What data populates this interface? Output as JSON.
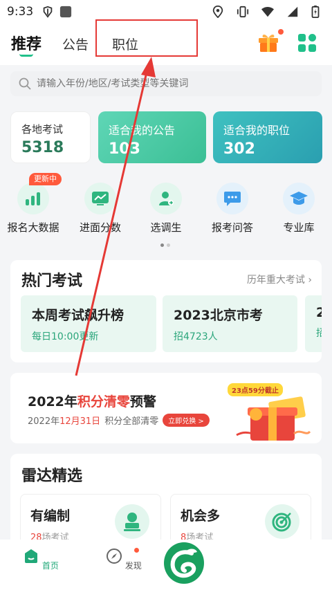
{
  "status_bar": {
    "time": "9:33",
    "icons": [
      "debug-bug-icon",
      "app-square-icon",
      "location-icon",
      "vibrate-icon",
      "wifi-icon",
      "signal-icon",
      "battery-icon"
    ]
  },
  "top_tabs": [
    {
      "label": "推荐",
      "active": true
    },
    {
      "label": "公告",
      "active": false
    },
    {
      "label": "职位",
      "active": false
    }
  ],
  "search": {
    "placeholder": "请输入年份/地区/考试类型等关键词"
  },
  "stats": {
    "local_exams": {
      "label": "各地考试",
      "value": "5318"
    },
    "my_announcements": {
      "label": "适合我的公告",
      "value": "103"
    },
    "my_positions": {
      "label": "适合我的职位",
      "value": "302"
    }
  },
  "features": {
    "updating_badge": "更新中",
    "items": [
      {
        "label": "报名大数据",
        "icon": "bar-chart-icon"
      },
      {
        "label": "进面分数",
        "icon": "line-chart-icon"
      },
      {
        "label": "选调生",
        "icon": "person-icon"
      },
      {
        "label": "报考问答",
        "icon": "chat-bubble-icon"
      },
      {
        "label": "专业库",
        "icon": "graduation-cap-icon"
      }
    ]
  },
  "hot_exams": {
    "title": "热门考试",
    "more_label": "历年重大考试",
    "cards": [
      {
        "title": "本周考试飙升榜",
        "subtitle": "每日10:00更新"
      },
      {
        "title": "2023北京市考",
        "subtitle": "招4723人"
      },
      {
        "title": "2",
        "subtitle": "招"
      }
    ]
  },
  "promo": {
    "title_prefix": "2022年",
    "title_highlight": "积分清零",
    "title_suffix": "预警",
    "date_prefix": "2022年",
    "date_highlight": "12月31日",
    "date_suffix": "积分全部清零",
    "redeem_label": "立即兑换 >",
    "deadline_badge": "23点59分截止"
  },
  "radar": {
    "title": "雷达精选",
    "cards": [
      {
        "title": "有编制",
        "count": "28",
        "count_suffix": "场考试",
        "icon": "stamp-icon"
      },
      {
        "title": "机会多",
        "count": "8",
        "count_suffix": "场考试",
        "icon": "target-icon"
      }
    ]
  },
  "bottom_nav": {
    "home_label": "首页",
    "discover_label": "发现"
  },
  "colors": {
    "accent_green": "#20c08a",
    "highlight_red": "#e53935",
    "promo_red": "#e8453c"
  }
}
